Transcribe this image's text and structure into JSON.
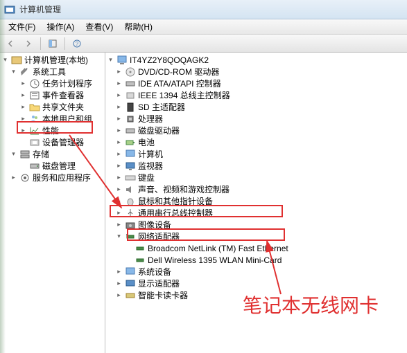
{
  "titlebar": {
    "title": "计算机管理"
  },
  "menubar": {
    "file": "文件(F)",
    "action": "操作(A)",
    "view": "查看(V)",
    "help": "帮助(H)"
  },
  "leftTree": {
    "root": "计算机管理(本地)",
    "systemTools": "系统工具",
    "taskScheduler": "任务计划程序",
    "eventViewer": "事件查看器",
    "sharedFolders": "共享文件夹",
    "localUsers": "本地用户和组",
    "performance": "性能",
    "deviceManager": "设备管理器",
    "storage": "存储",
    "diskManagement": "磁盘管理",
    "services": "服务和应用程序"
  },
  "rightTree": {
    "computer": "IT4YZ2Y8QOQAGK2",
    "dvd": "DVD/CD-ROM 驱动器",
    "ide": "IDE ATA/ATAPI 控制器",
    "ieee": "IEEE 1394 总线主控制器",
    "sd": "SD 主适配器",
    "cpu": "处理器",
    "diskDrive": "磁盘驱动器",
    "battery": "电池",
    "computer2": "计算机",
    "monitor": "监视器",
    "keyboard": "键盘",
    "sound": "声音、视频和游戏控制器",
    "mouse": "鼠标和其他指针设备",
    "usb": "通用串行总线控制器",
    "imaging": "图像设备",
    "network": "网络适配器",
    "broadcom": "Broadcom NetLink (TM) Fast Ethernet",
    "dell": "Dell Wireless 1395 WLAN Mini-Card",
    "system": "系统设备",
    "display": "显示适配器",
    "smartcard": "智能卡读卡器"
  },
  "annotation": "笔记本无线网卡"
}
